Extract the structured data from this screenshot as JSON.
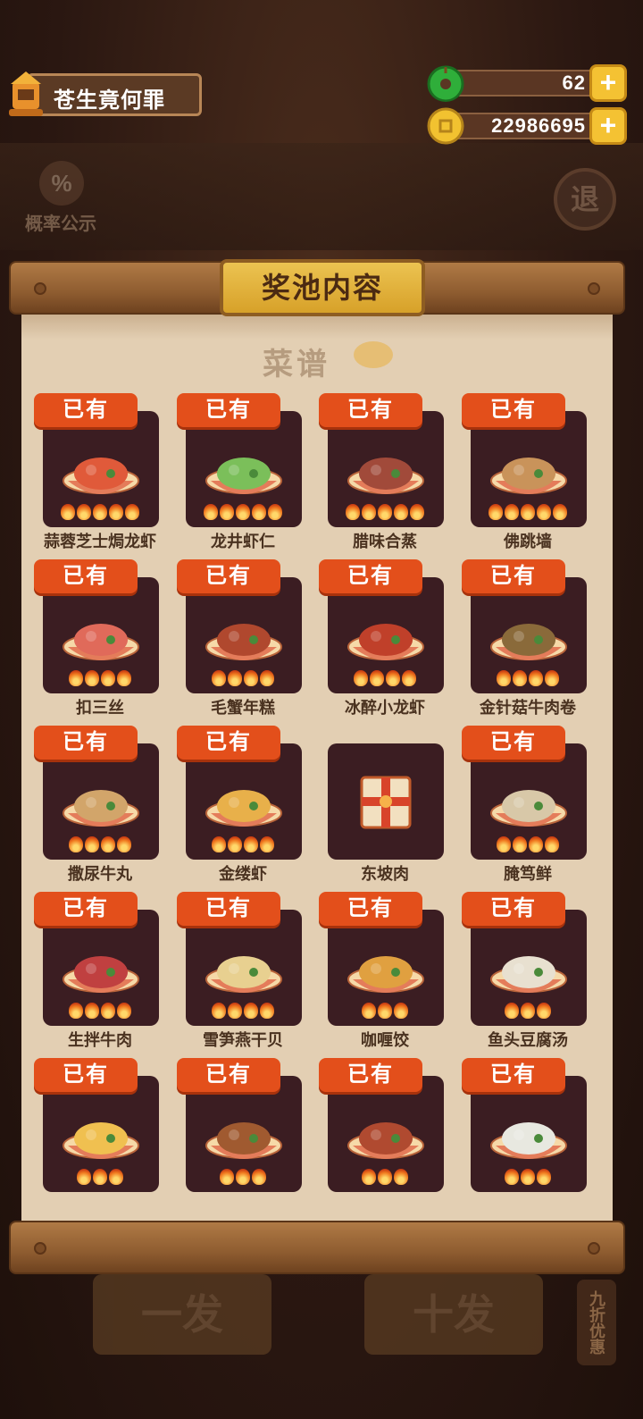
{
  "player": {
    "name": "苍生竟何罪"
  },
  "resources": {
    "jade": "62",
    "coins": "22986695",
    "plus_label": "+"
  },
  "top": {
    "probability_label": "概率公示",
    "probability_symbol": "%",
    "exit_label": "退"
  },
  "modal": {
    "title": "奖池内容",
    "category": "菜谱"
  },
  "owned_label": "已有",
  "dishes": [
    {
      "name": "蒜蓉芝士焗龙虾",
      "owned": true,
      "flames": 5,
      "color": "#e05a3a"
    },
    {
      "name": "龙井虾仁",
      "owned": true,
      "flames": 5,
      "color": "#7bbf5a"
    },
    {
      "name": "腊味合蒸",
      "owned": true,
      "flames": 5,
      "color": "#a14a3a"
    },
    {
      "name": "佛跳墙",
      "owned": true,
      "flames": 5,
      "color": "#c9935a"
    },
    {
      "name": "扣三丝",
      "owned": true,
      "flames": 4,
      "color": "#e06a5a"
    },
    {
      "name": "毛蟹年糕",
      "owned": true,
      "flames": 4,
      "color": "#b0482e"
    },
    {
      "name": "冰醉小龙虾",
      "owned": true,
      "flames": 4,
      "color": "#c0402a"
    },
    {
      "name": "金针菇牛肉卷",
      "owned": true,
      "flames": 4,
      "color": "#8a6a3a"
    },
    {
      "name": "撒尿牛丸",
      "owned": true,
      "flames": 4,
      "color": "#d2a56a"
    },
    {
      "name": "金缕虾",
      "owned": true,
      "flames": 4,
      "color": "#e8b04a"
    },
    {
      "name": "东坡肉",
      "owned": false,
      "flames": 0,
      "color": "#d89a5a"
    },
    {
      "name": "腌笃鲜",
      "owned": true,
      "flames": 4,
      "color": "#d8c8a8"
    },
    {
      "name": "生拌牛肉",
      "owned": true,
      "flames": 4,
      "color": "#c04040"
    },
    {
      "name": "雪笋燕干贝",
      "owned": true,
      "flames": 4,
      "color": "#e8d090"
    },
    {
      "name": "咖喱饺",
      "owned": true,
      "flames": 3,
      "color": "#e0a040"
    },
    {
      "name": "鱼头豆腐汤",
      "owned": true,
      "flames": 3,
      "color": "#e8e0d0"
    },
    {
      "name": "",
      "owned": true,
      "flames": 3,
      "color": "#f0c050"
    },
    {
      "name": "",
      "owned": true,
      "flames": 3,
      "color": "#a05a30"
    },
    {
      "name": "",
      "owned": true,
      "flames": 3,
      "color": "#b04a30"
    },
    {
      "name": "",
      "owned": true,
      "flames": 3,
      "color": "#e8e8e0"
    }
  ],
  "bottom": {
    "single_draw": "一发",
    "ten_draw": "十发",
    "discount": "九折优惠"
  }
}
